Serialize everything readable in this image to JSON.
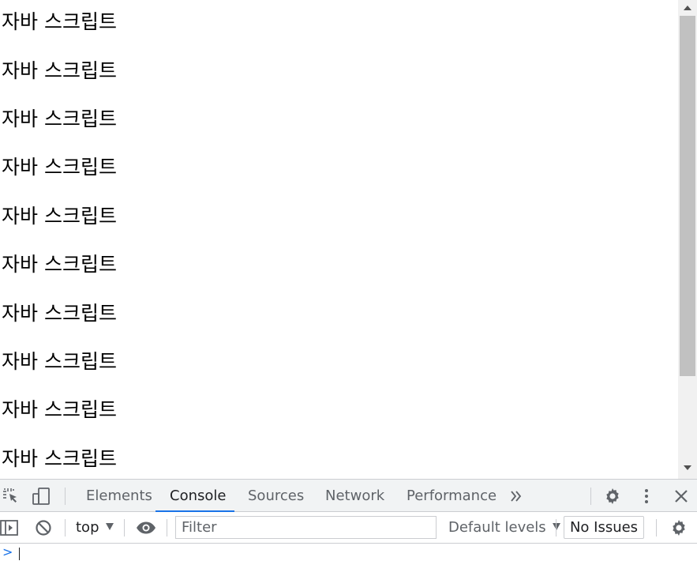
{
  "page": {
    "lines": [
      "자바 스크립트",
      "자바 스크립트",
      "자바 스크립트",
      "자바 스크립트",
      "자바 스크립트",
      "자바 스크립트",
      "자바 스크립트",
      "자바 스크립트",
      "자바 스크립트",
      "자바 스크립트"
    ]
  },
  "devtools": {
    "tabs": [
      "Elements",
      "Console",
      "Sources",
      "Network",
      "Performance"
    ],
    "active_tab": "Console",
    "more_tabs_icon": "chevron-double-right-icon",
    "toolbar": {
      "context": "top",
      "filter_placeholder": "Filter",
      "filter_value": "",
      "levels": "Default levels",
      "issues": "No Issues"
    },
    "prompt": ">"
  },
  "colors": {
    "accent": "#1a73e8",
    "tab_bar_bg": "#f1f3f4",
    "border": "#cbcdd1",
    "icon": "#5f6368"
  }
}
